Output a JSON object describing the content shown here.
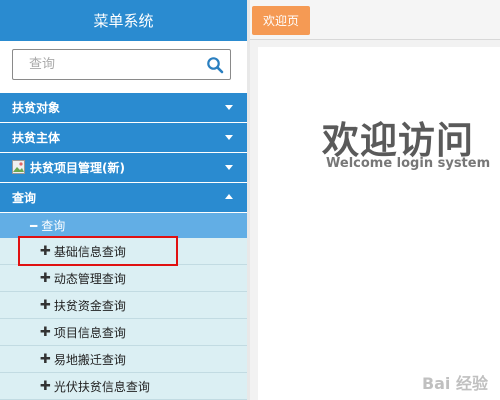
{
  "sidebar": {
    "title": "菜单系统",
    "search": {
      "placeholder": "查询"
    },
    "menu": [
      {
        "label": "扶贫对象",
        "expanded": false
      },
      {
        "label": "扶贫主体",
        "expanded": false
      },
      {
        "label": "扶贫项目管理(新)",
        "expanded": false,
        "icon": "broken-image-icon"
      },
      {
        "label": "查询",
        "expanded": true
      }
    ],
    "query_group": {
      "label": "查询",
      "items": [
        "基础信息查询",
        "动态管理查询",
        "扶贫资金查询",
        "项目信息查询",
        "易地搬迁查询",
        "光伏扶贫信息查询"
      ]
    }
  },
  "main": {
    "tab_label": "欢迎页",
    "welcome_title": "欢迎访问",
    "welcome_subtitle": "Welcome login system"
  },
  "watermark": "Bai 经验",
  "colors": {
    "menu_blue": "#2a8bd0",
    "sub_blue": "#62aee5",
    "tab_orange": "#f59a54",
    "sidebar_bg": "#dbeff3",
    "highlight_red": "#e01010"
  }
}
